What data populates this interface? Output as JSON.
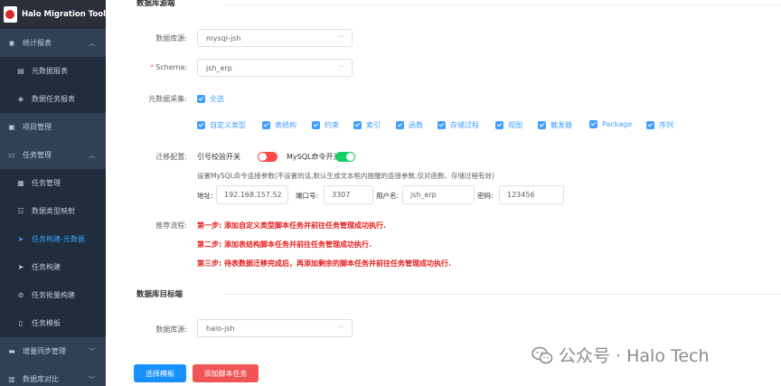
{
  "app": {
    "title": "Halo Migration Tool"
  },
  "sidebar": {
    "items": [
      {
        "label": "统计报表",
        "icon": "dashboard-icon",
        "arrow": "︿"
      },
      {
        "label": "元数据报表",
        "icon": "report-icon"
      },
      {
        "label": "数据任务报表",
        "icon": "report-icon"
      },
      {
        "label": "项目管理",
        "icon": "project-icon"
      },
      {
        "label": "任务管理",
        "icon": "task-icon",
        "arrow": "︿"
      },
      {
        "label": "任务管理",
        "icon": "list-icon"
      },
      {
        "label": "数据类型映射",
        "icon": "mapping-icon"
      },
      {
        "label": "任务构建-元数据",
        "icon": "send-icon"
      },
      {
        "label": "任务构建",
        "icon": "send-icon"
      },
      {
        "label": "任务批量构建",
        "icon": "batch-icon"
      },
      {
        "label": "任务模板",
        "icon": "template-icon"
      },
      {
        "label": "增量同步管理",
        "icon": "sync-icon",
        "arrow": "﹀"
      },
      {
        "label": "数据库对比",
        "icon": "compare-icon",
        "arrow": "﹀"
      }
    ]
  },
  "source": {
    "section_title": "数据库源端",
    "db_label": "数据库源:",
    "db_value": "mysql-jsh",
    "schema_required_mark": "*",
    "schema_label": "Schema:",
    "schema_value": "jsh_erp",
    "collect_label": "元数据采集:",
    "select_all": "全选",
    "options": [
      "自定义类型",
      "表结构",
      "约束",
      "索引",
      "函数",
      "存储过程",
      "视图",
      "触发器",
      "Package",
      "序列"
    ]
  },
  "migration": {
    "label": "迁移配置:",
    "switch1_label": "引号校验开关",
    "switch1_on": false,
    "switch2_label": "MySQL命令开关:",
    "switch2_on": true,
    "hint": "设置MySQL命令连接参数(不设置的话,默认生成文本框内提醒的连接参数,仅对函数、存储过程有效)",
    "addr_label": "地址:",
    "addr_value": "192.168.157.52",
    "port_label": "端口号:",
    "port_value": "3307",
    "user_label": "用户名:",
    "user_value": "jsh_erp",
    "pwd_label": "密码:",
    "pwd_value": "123456"
  },
  "process": {
    "label": "推荐流程:",
    "steps": [
      "第一步: 添加自定义类型脚本任务并前往任务管理成功执行.",
      "第二步: 添加表结构脚本任务并前往任务管理成功执行.",
      "第三步: 待表数据迁移完成后，再添加剩余的脚本任务并前往任务管理成功执行."
    ]
  },
  "target": {
    "section_title": "数据库目标端",
    "db_label": "数据库源:",
    "db_value": "halo-jsh"
  },
  "actions": {
    "select_template": "选择模板",
    "add_script_task": "添加脚本任务"
  },
  "watermark": {
    "text": "公众号 · Halo Tech"
  },
  "colors": {
    "accent": "#409eff",
    "sidebar": "#304156",
    "danger": "#f05454",
    "success": "#13ce66"
  }
}
